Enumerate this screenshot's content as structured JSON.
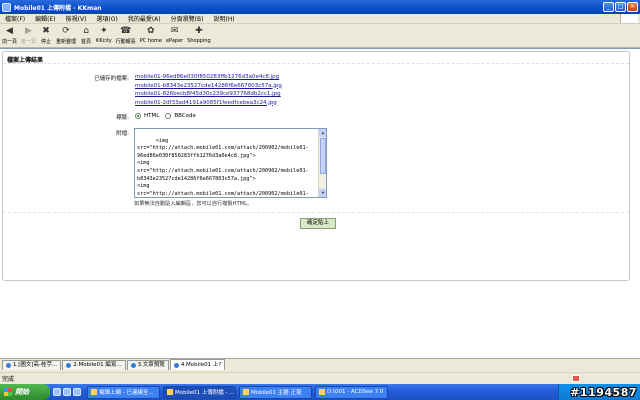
{
  "window": {
    "title": "Mobile01 上傳附檔 - KKman"
  },
  "menu": [
    "檔案(F)",
    "編輯(E)",
    "檢視(V)",
    "選項(O)",
    "我的最愛(A)",
    "分頁瀏覽(B)",
    "說明(H)"
  ],
  "toolbar": [
    {
      "label": "前一頁",
      "icon": "back-icon",
      "glyph": "◀",
      "enabled": true
    },
    {
      "label": "後一頁",
      "icon": "forward-icon",
      "glyph": "▶",
      "enabled": false
    },
    {
      "label": "停止",
      "icon": "stop-icon",
      "glyph": "✖",
      "enabled": true
    },
    {
      "label": "重新整理",
      "icon": "refresh-icon",
      "glyph": "⟳",
      "enabled": true
    },
    {
      "label": "首頁",
      "icon": "home-icon",
      "glyph": "⌂",
      "enabled": true
    },
    {
      "label": "KKcity",
      "icon": "kkcity-icon",
      "glyph": "✦",
      "enabled": true
    },
    {
      "label": "行動報喜",
      "icon": "mobile-icon",
      "glyph": "☎",
      "enabled": true
    },
    {
      "label": "PC home",
      "icon": "pchome-icon",
      "glyph": "✿",
      "enabled": true
    },
    {
      "label": "ePaper",
      "icon": "epaper-icon",
      "glyph": "✉",
      "enabled": true
    },
    {
      "label": "Shopping",
      "icon": "shopping-icon",
      "glyph": "✚",
      "enabled": true
    }
  ],
  "panel": {
    "title": "檔案上傳結果",
    "uploaded_label": "已儲存的檔案:",
    "files": [
      "mobile01-96ed86e030f850283ffb1276d3a0e4c8.jpg",
      "mobile01-b8343e23527cde14286f6e667803c57a.jpg",
      "mobile01-826becb8f45d30c239ce937768db2cc1.jpg",
      "mobile01-2df33ad4191a9085f1feedfcebea3c24.jpg"
    ],
    "format_label": "標籤:",
    "format_options": [
      "HTML",
      "BBCode"
    ],
    "format_selected": "HTML",
    "code_label": "附檔:",
    "code_text": "<img\nsrc=\"http://attach.mobile01.com/attach/200902/mobile01-96ed86e030f850283ffb1276d3a0e4c8.jpg\">\n<img\nsrc=\"http://attach.mobile01.com/attach/200902/mobile01-b8343e23527cde14286f6e667803c57a.jpg\">\n<img\nsrc=\"http://attach.mobile01.com/attach/200902/mobile01-826becb8f45d30c239ce937768db2cc1.jpg\">",
    "hint": "如果無法自動貼入編輯區，您可以自行複製HTML。",
    "submit_label": "確定貼上"
  },
  "tabs": [
    {
      "label": "1.[圖文]高-桂苧...",
      "active": false
    },
    {
      "label": "2.Mobile01 編寫...",
      "active": false
    },
    {
      "label": "3.文章預覽",
      "active": false
    },
    {
      "label": "4.Mobile01 上?",
      "active": true
    }
  ],
  "status": {
    "text": "完成"
  },
  "taskbar": {
    "start_label": "開始",
    "buttons": [
      {
        "label": "電鍋上網 - 已連線至...",
        "active": false
      },
      {
        "label": "Mobile01 上傳附檔 - ...",
        "active": true
      },
      {
        "label": "Mobile01 主題 正寫",
        "active": false
      },
      {
        "label": "D:\\001 - ACDSee 7.0",
        "active": false
      }
    ],
    "watermark": "#1194587"
  }
}
